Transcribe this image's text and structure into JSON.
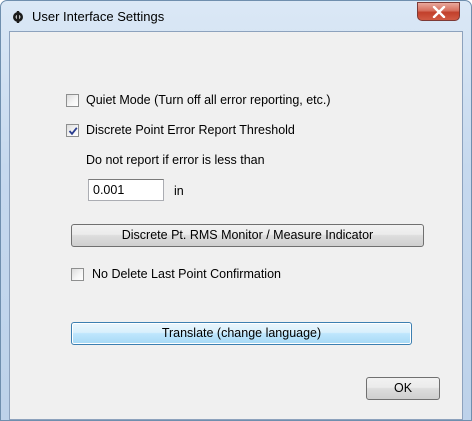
{
  "window": {
    "title": "User Interface Settings",
    "app_icon": "app-logo-icon",
    "close_icon": "close-icon"
  },
  "options": {
    "quiet_mode": {
      "label": "Quiet Mode (Turn off all error reporting, etc.)",
      "checked": false
    },
    "discrete_threshold": {
      "label": "Discrete Point Error Report Threshold",
      "checked": true,
      "description": "Do not report if error is less than",
      "value": "0.001",
      "unit": "in"
    },
    "no_delete_confirmation": {
      "label": "No Delete Last Point Confirmation",
      "checked": false
    }
  },
  "buttons": {
    "rms_monitor": "Discrete Pt. RMS Monitor / Measure Indicator",
    "translate": "Translate (change language)",
    "ok": "OK"
  },
  "colors": {
    "focus_accent": "#3c7fb1",
    "close_red": "#c2402b",
    "title_frame": "#c6d9ee"
  }
}
